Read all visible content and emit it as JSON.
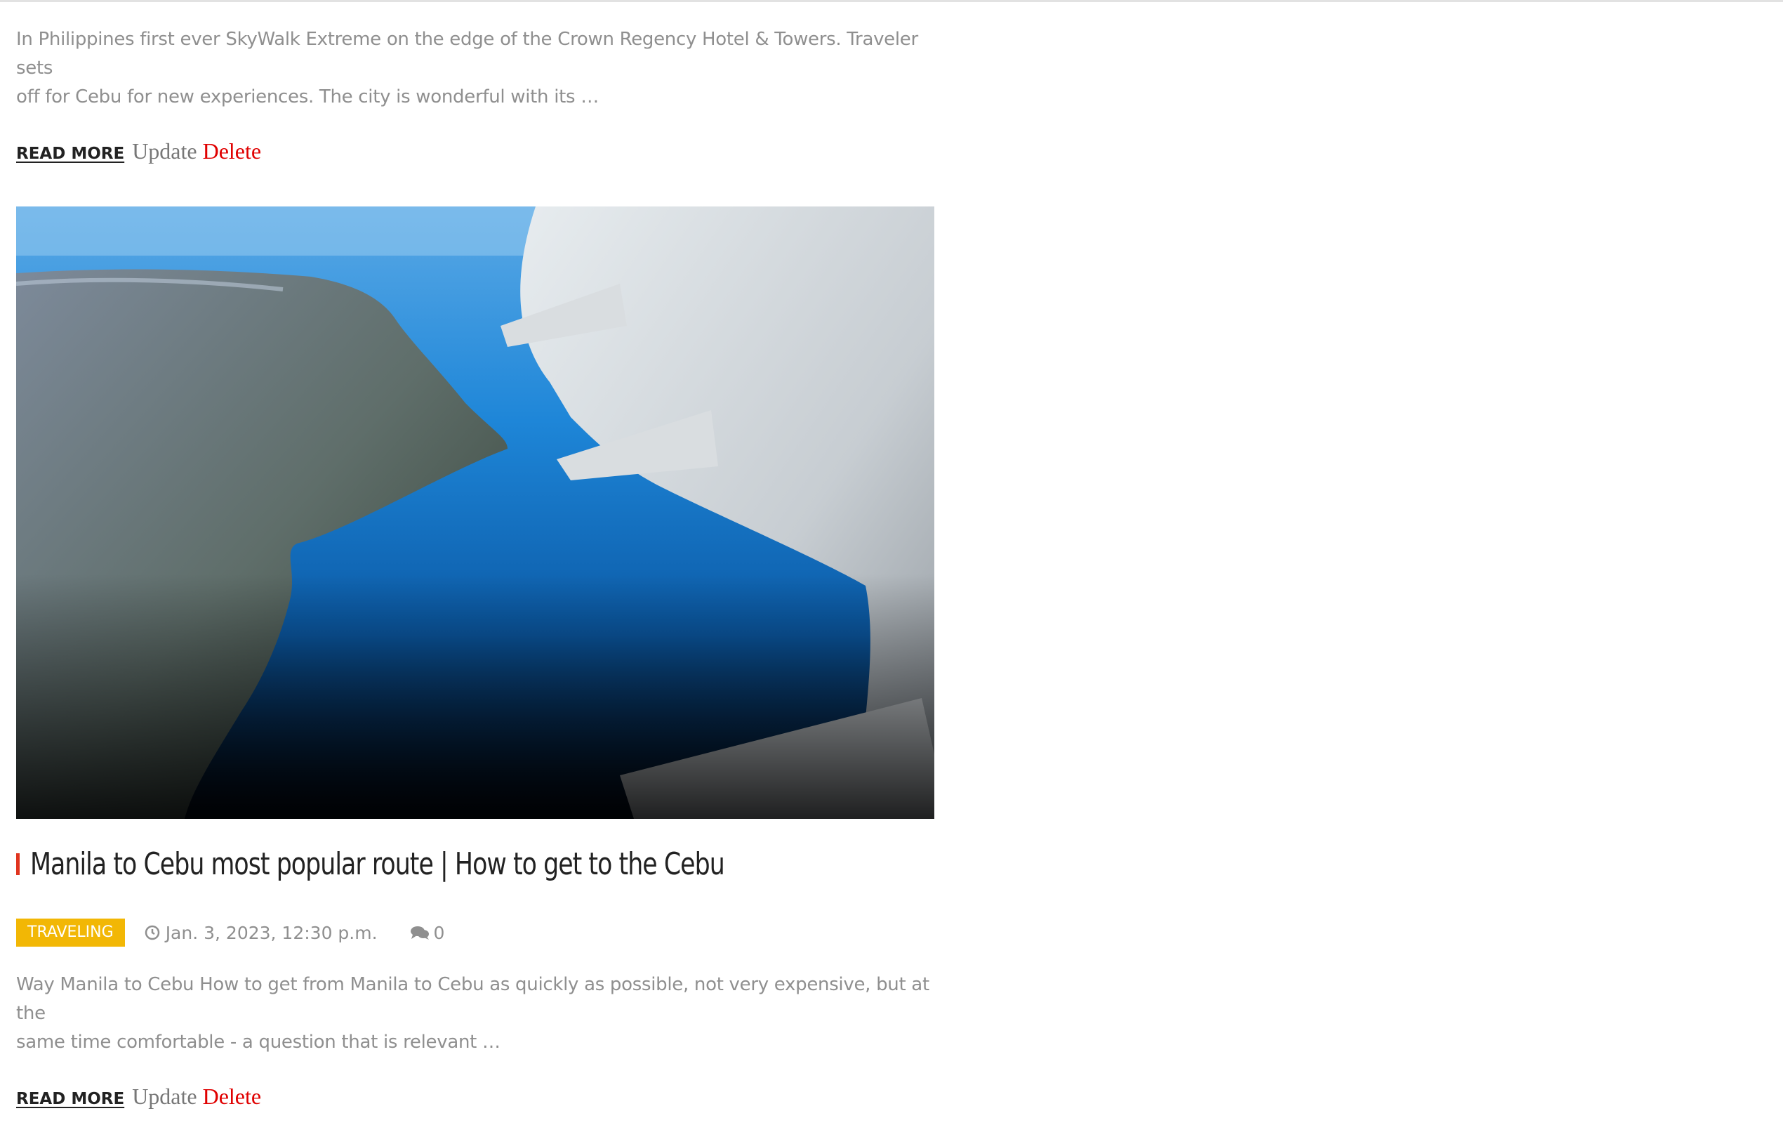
{
  "posts": [
    {
      "excerpt_line1": "In Philippines first ever SkyWalk Extreme on the edge of the Crown Regency Hotel & Towers. Traveler sets",
      "excerpt_line2": "off for Cebu for new experiences. The city is wonderful with its …",
      "read_more": "READ MORE",
      "update": "Update",
      "delete": "Delete"
    },
    {
      "title": "Manila to Cebu most popular route | How to get to the Cebu",
      "category": "TRAVELING",
      "date": "Jan. 3, 2023, 12:30 p.m.",
      "comments": "0",
      "excerpt_line1": "Way Manila to Cebu How to get from Manila to Cebu as quickly as possible, not very expensive, but at the",
      "excerpt_line2": "same time comfortable - a question that is relevant …",
      "read_more": "READ MORE",
      "update": "Update",
      "delete": "Delete"
    }
  ],
  "icons": {
    "date": "clock-icon",
    "comments": "comments-icon"
  },
  "colors": {
    "accent_bar": "#e0341f",
    "category_badge": "#f2b705",
    "delete": "#e00000"
  }
}
